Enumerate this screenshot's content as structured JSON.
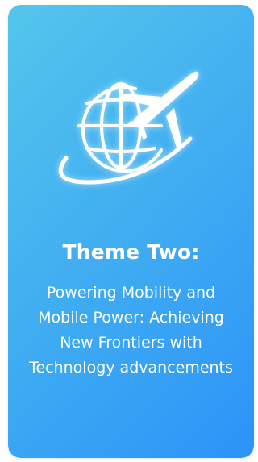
{
  "card": {
    "icon": "globe-airplane-icon",
    "title": "Theme Two:",
    "subtitle": "Powering Mobility and Mobile Power: Achieving New Frontiers with Technology advancements"
  },
  "colors": {
    "gradient_start": "#54c6ec",
    "gradient_end": "#2c93f8",
    "text": "#ffffff"
  }
}
